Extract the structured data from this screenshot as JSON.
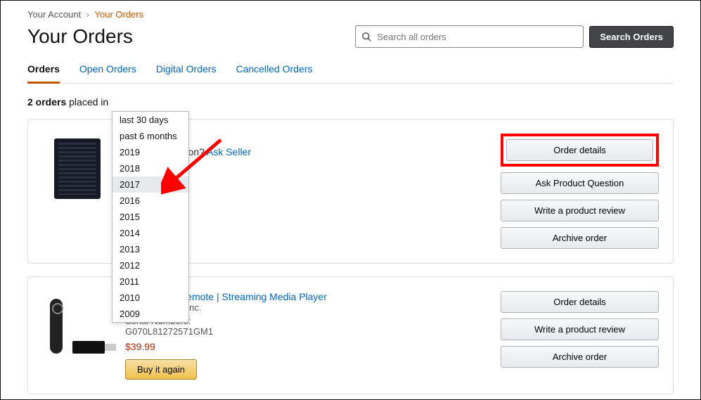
{
  "breadcrumb": {
    "root": "Your Account",
    "current": "Your Orders"
  },
  "page_title": "Your Orders",
  "search": {
    "placeholder": "Search all orders",
    "button": "Search Orders"
  },
  "tabs": [
    {
      "label": "Orders",
      "active": true
    },
    {
      "label": "Open Orders",
      "active": false
    },
    {
      "label": "Digital Orders",
      "active": false
    },
    {
      "label": "Cancelled Orders",
      "active": false
    }
  ],
  "count_line": {
    "count": "2 orders",
    "suffix": " placed in"
  },
  "dropdown": {
    "options": [
      "last 30 days",
      "past 6 months",
      "2019",
      "2018",
      "2017",
      "2016",
      "2015",
      "2014",
      "2013",
      "2012",
      "2011",
      "2010",
      "2009"
    ],
    "hovered": "2017"
  },
  "orders": [
    {
      "pq_prefix": "Product question? ",
      "pq_link": "Ask Seller",
      "actions": [
        "Order details",
        "Ask Product Question",
        "Write a product review",
        "Archive order"
      ],
      "highlight_action_index": 0
    },
    {
      "title_fragment": " Alexa Voice Remote | Streaming Media Player",
      "vendor_fragment": "igital Services, Inc.",
      "serial_label": "Serial Numbers:",
      "serial_value": "G070L81272571GM1",
      "price": "$39.99",
      "buy_again": "Buy it again",
      "actions": [
        "Order details",
        "Write a product review",
        "Archive order"
      ]
    }
  ]
}
